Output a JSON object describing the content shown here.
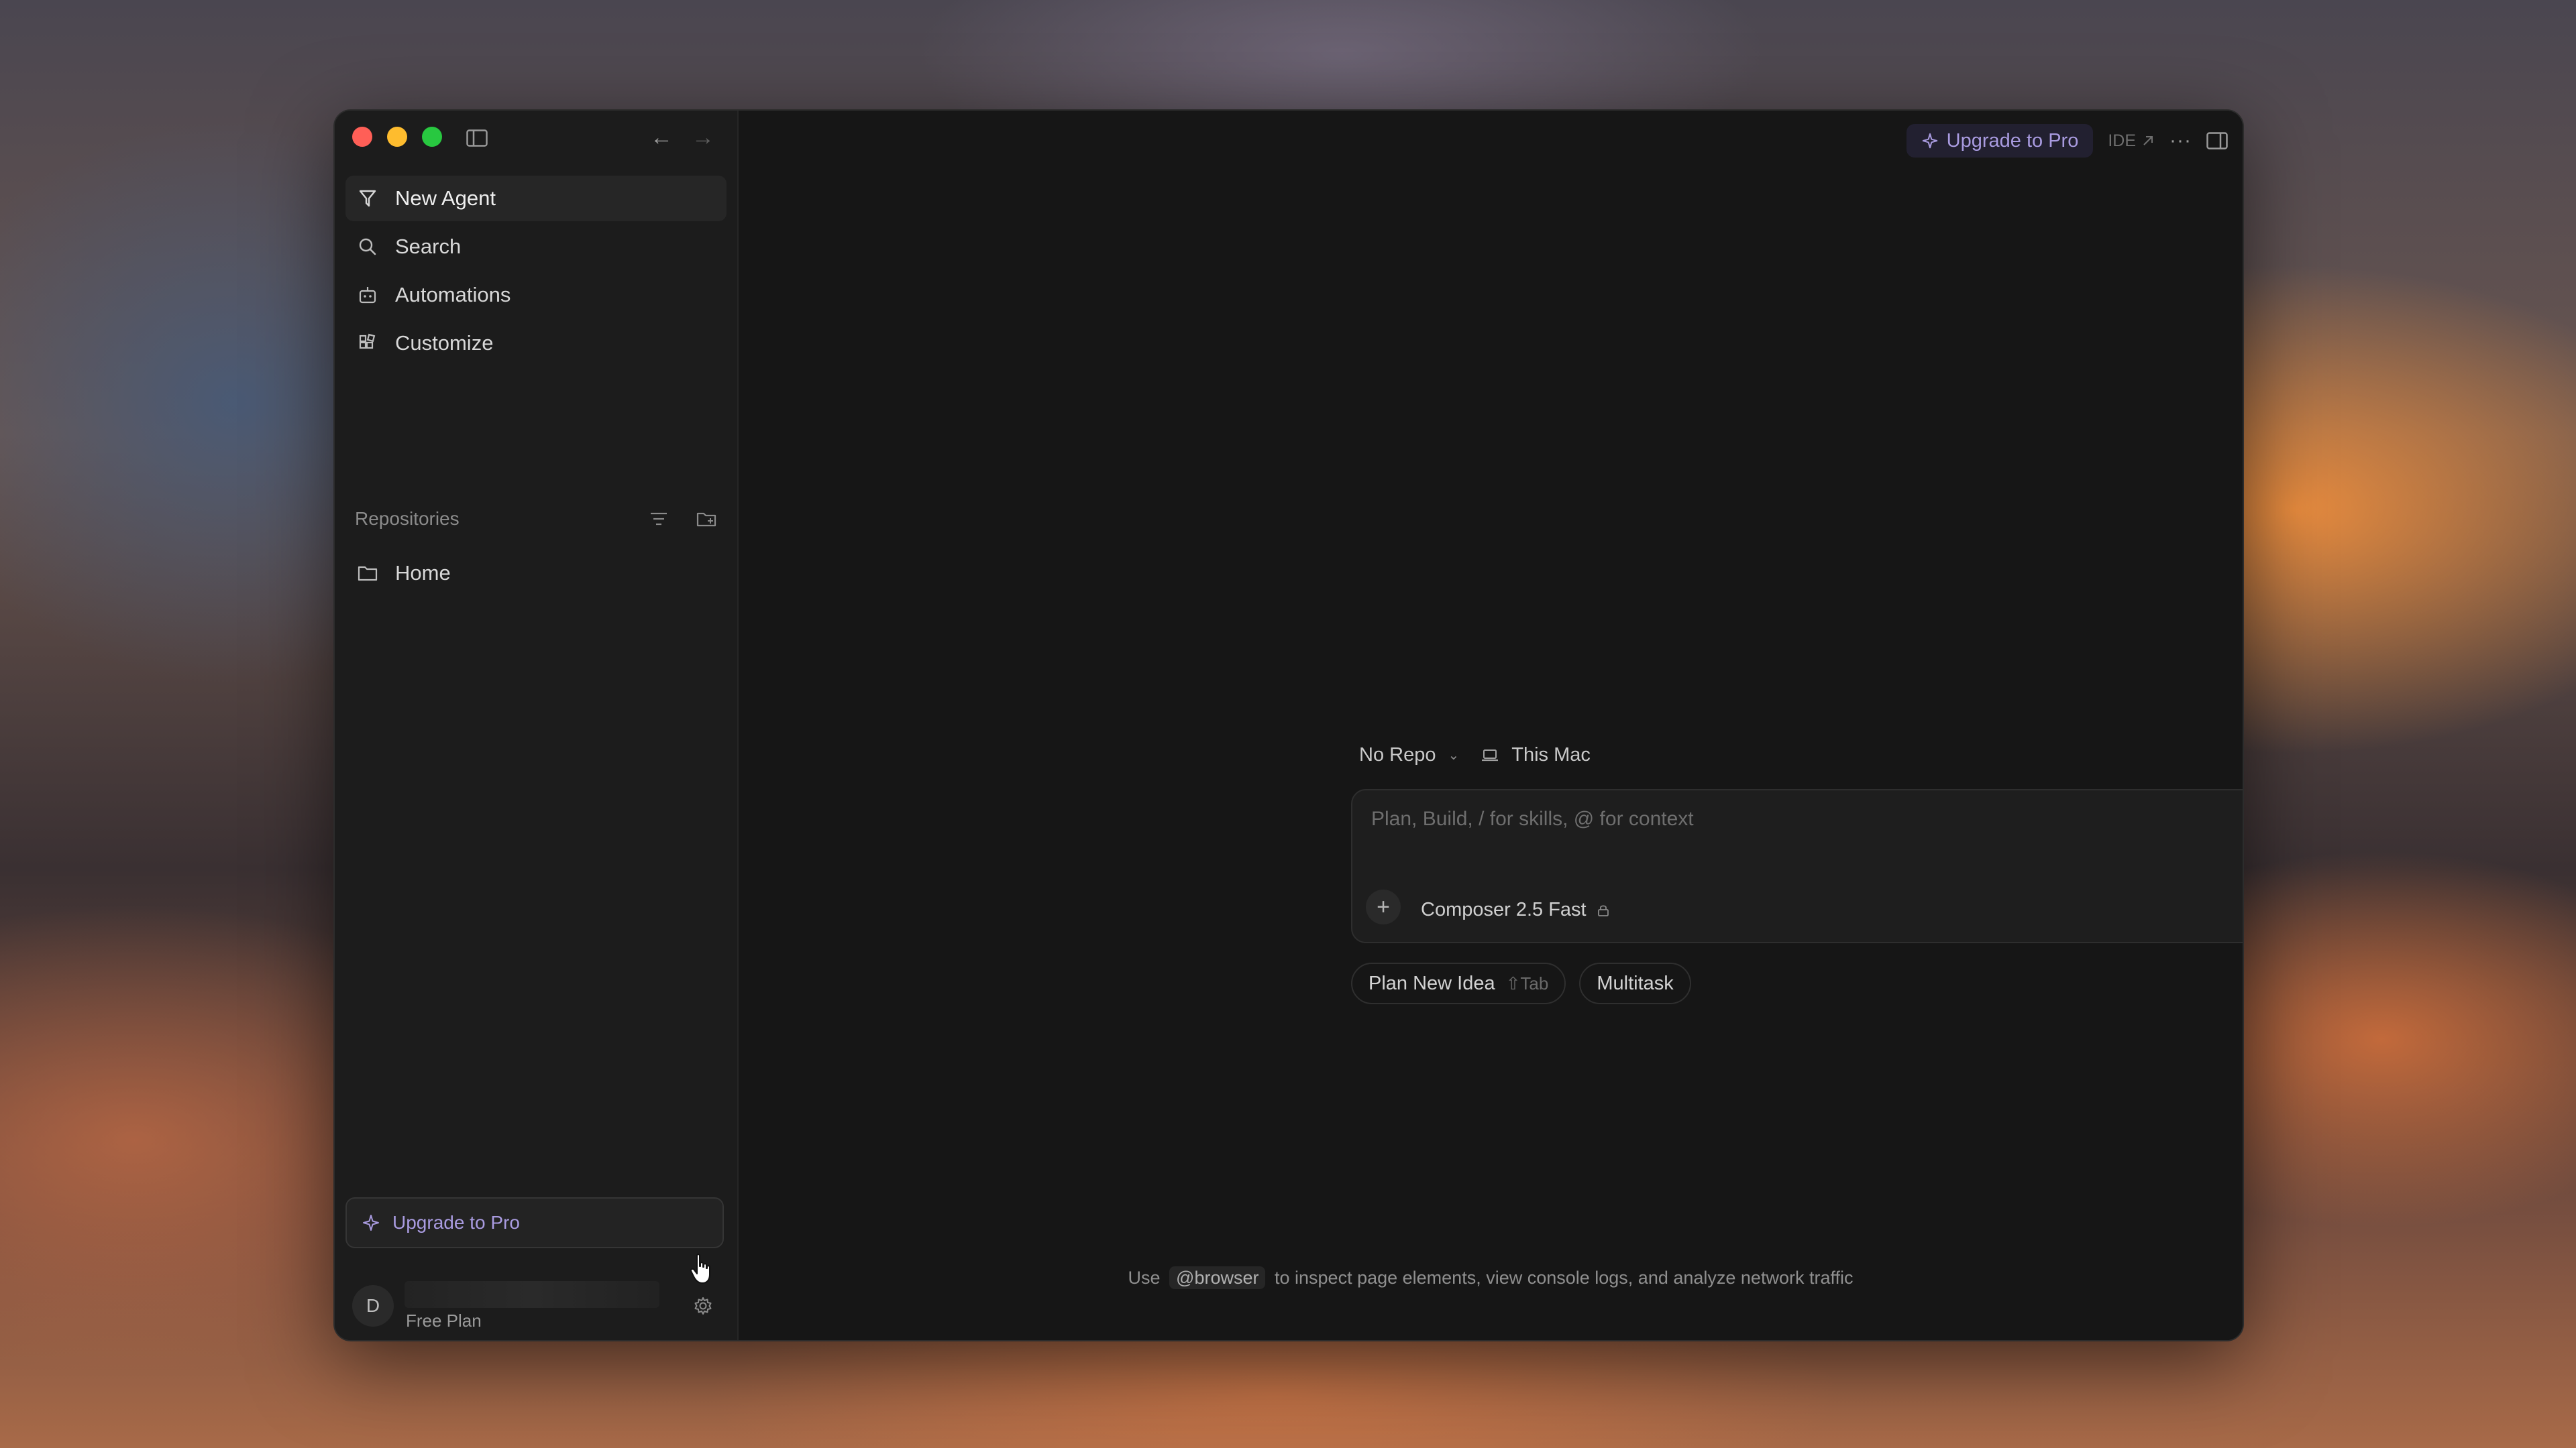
{
  "sidebar": {
    "menu": [
      {
        "label": "New Agent",
        "icon": "new-agent-icon"
      },
      {
        "label": "Search",
        "icon": "search-icon"
      },
      {
        "label": "Automations",
        "icon": "automations-icon"
      },
      {
        "label": "Customize",
        "icon": "customize-icon"
      }
    ],
    "repositories_title": "Repositories",
    "repositories": [
      {
        "label": "Home",
        "icon": "folder-icon"
      }
    ],
    "upgrade_label": "Upgrade to Pro",
    "user": {
      "avatar_initial": "D",
      "plan": "Free Plan"
    }
  },
  "topbar": {
    "upgrade_label": "Upgrade to Pro",
    "ide_label": "IDE",
    "more_label": "···"
  },
  "composer": {
    "repo_selector": "No Repo",
    "machine_label": "This Mac",
    "placeholder": "Plan, Build, / for skills, @ for context",
    "model_label": "Composer 2.5 Fast",
    "chips": [
      {
        "label": "Plan New Idea",
        "hint": "Tab"
      },
      {
        "label": "Multitask"
      }
    ]
  },
  "footer_tip": {
    "prefix": "Use",
    "code": "@browser",
    "suffix": "to inspect page elements, view console logs, and analyze network traffic"
  },
  "colors": {
    "accent_purple": "#a99be0",
    "window_bg": "#171717",
    "sidebar_bg": "#1c1c1c"
  }
}
